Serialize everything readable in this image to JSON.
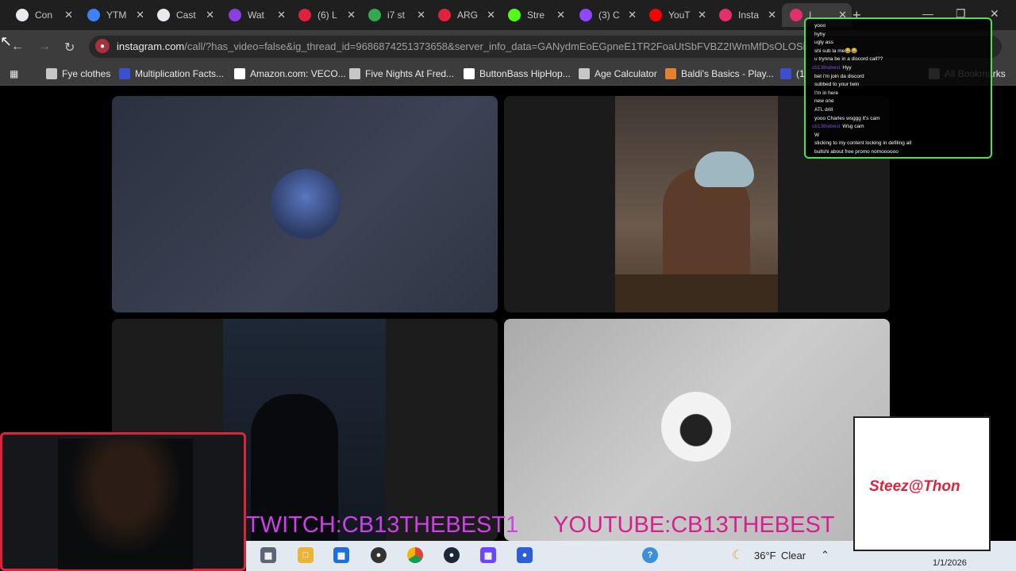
{
  "tabs": [
    {
      "label": "Con",
      "icon": "github-icon",
      "color": "#e8eaed"
    },
    {
      "label": "YTM",
      "icon": "youtube-music-icon",
      "color": "#3b82f6"
    },
    {
      "label": "Cast",
      "icon": "loading-icon",
      "color": "#e8eaed"
    },
    {
      "label": "Wat",
      "icon": "app-icon",
      "color": "#8b3fe0"
    },
    {
      "label": "(6) L",
      "icon": "app-icon",
      "color": "#e0233c"
    },
    {
      "label": "i7 st",
      "icon": "drive-icon",
      "color": "#34a853"
    },
    {
      "label": "ARG",
      "icon": "flag-icon",
      "color": "#e0233c"
    },
    {
      "label": "Stre",
      "icon": "kick-icon",
      "color": "#53fc18"
    },
    {
      "label": "(3) C",
      "icon": "twitch-icon",
      "color": "#9146ff"
    },
    {
      "label": "YouT",
      "icon": "youtube-icon",
      "color": "#ff0000"
    },
    {
      "label": "Insta",
      "icon": "instagram-icon",
      "color": "#e1306c"
    },
    {
      "label": "I",
      "icon": "instagram-icon",
      "color": "#e1306c"
    }
  ],
  "url": {
    "host": "instagram.com",
    "path": "/call/?has_video=false&ig_thread_id=9686874251373658&server_info_data=GANydmEoEGpneE1TR2FoaUtSbFVBZ2IWmMfDsOLOSiAA"
  },
  "bookmarks": [
    {
      "label": "Fye clothes",
      "icon": "folder-icon",
      "color": "#c7c7c7"
    },
    {
      "label": "Multiplication Facts...",
      "icon": "m-icon",
      "color": "#3b4fcf"
    },
    {
      "label": "Amazon.com: VECO...",
      "icon": "amazon-icon",
      "color": "#ffffff"
    },
    {
      "label": "Five Nights At Fred...",
      "icon": "globe-icon",
      "color": "#c7c7c7"
    },
    {
      "label": "ButtonBass HipHop...",
      "icon": "piano-icon",
      "color": "#ffffff"
    },
    {
      "label": "Age Calculator",
      "icon": "calendar-icon",
      "color": "#c7c7c7"
    },
    {
      "label": "Baldi's Basics - Play...",
      "icon": "baldi-icon",
      "color": "#e08030"
    },
    {
      "label": "(1",
      "icon": "app-icon",
      "color": "#3b4fcf"
    },
    {
      "label": "All Bookmarks",
      "icon": "folder-icon",
      "color": "#c7c7c7"
    }
  ],
  "chat": [
    {
      "user": "",
      "msg": "yooo"
    },
    {
      "user": "",
      "msg": "hyhy"
    },
    {
      "user": "",
      "msg": "ugly ass"
    },
    {
      "user": "",
      "msg": "shi sub la me😂😂"
    },
    {
      "user": "",
      "msg": "u trynna be in a discord call??"
    },
    {
      "user": "cb13thebest",
      "msg": "Hyy"
    },
    {
      "user": "",
      "msg": "bet i'm join da discord"
    },
    {
      "user": "",
      "msg": "subbed to your twin"
    },
    {
      "user": "",
      "msg": "I'm in here"
    },
    {
      "user": "",
      "msg": "new one"
    },
    {
      "user": "",
      "msg": "ATL drill"
    },
    {
      "user": "",
      "msg": "yooo Charles wsggg it's cam"
    },
    {
      "user": "cb13thebest",
      "msg": "Wsg cam"
    },
    {
      "user": "",
      "msg": "W"
    },
    {
      "user": "",
      "msg": "sticking to my content locking in defiling all"
    },
    {
      "user": "",
      "msg": "bullshi about free promo nomoooooo"
    }
  ],
  "overlay": {
    "twitch": "TWITCH:CB13THEBEST1",
    "youtube": "YOUTUBE:CB13THEBEST",
    "logo_text": "Steez@Thon"
  },
  "taskbar": {
    "temperature": "36°F",
    "weather": "Clear",
    "date": "1/1/2026"
  }
}
